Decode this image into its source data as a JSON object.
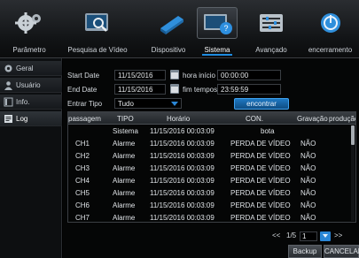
{
  "nav": {
    "tabs": [
      {
        "label": "Parâmetro",
        "icon": "gear-icon"
      },
      {
        "label": "Pesquisa de Vídeo",
        "icon": "video-search-icon"
      },
      {
        "label": "Dispositivo",
        "icon": "hard-disk-icon"
      },
      {
        "label": "Sistema",
        "icon": "system-info-icon"
      },
      {
        "label": "Avançado",
        "icon": "advanced-tools-icon"
      },
      {
        "label": "encerramento",
        "icon": "power-icon"
      }
    ],
    "active_tab": "Sistema"
  },
  "sidebar": {
    "items": [
      {
        "label": "Geral",
        "icon": "gear-small-icon"
      },
      {
        "label": "Usuário",
        "icon": "user-icon"
      },
      {
        "label": "Info.",
        "icon": "info-icon"
      },
      {
        "label": "Log",
        "icon": "log-icon"
      }
    ],
    "active_item": "Log"
  },
  "filters": {
    "start_date_label": "Start Date",
    "start_date": "11/15/2016",
    "start_time_label": "hora início",
    "start_time": "00:00:00",
    "end_date_label": "End Date",
    "end_date": "11/15/2016",
    "end_time_label": "fim tempos",
    "end_time": "23:59:59",
    "type_label": "Entrar Tipo",
    "type_value": "Tudo",
    "search_label": "encontrar"
  },
  "table": {
    "headers": [
      "passagem",
      "TIPO",
      "Horário",
      "CON.",
      "Gravação",
      "produção"
    ],
    "rows": [
      {
        "channel": "",
        "type": "Sistema",
        "time": "11/15/2016 00:03:09",
        "content": "bota",
        "record": ""
      },
      {
        "channel": "CH1",
        "type": "Alarme",
        "time": "11/15/2016 00:03:09",
        "content": "PERDA DE VÍDEO",
        "record": "NÃO"
      },
      {
        "channel": "CH2",
        "type": "Alarme",
        "time": "11/15/2016 00:03:09",
        "content": "PERDA DE VÍDEO",
        "record": "NÃO"
      },
      {
        "channel": "CH3",
        "type": "Alarme",
        "time": "11/15/2016 00:03:09",
        "content": "PERDA DE VÍDEO",
        "record": "NÃO"
      },
      {
        "channel": "CH4",
        "type": "Alarme",
        "time": "11/15/2016 00:03:09",
        "content": "PERDA DE VÍDEO",
        "record": "NÃO"
      },
      {
        "channel": "CH5",
        "type": "Alarme",
        "time": "11/15/2016 00:03:09",
        "content": "PERDA DE VÍDEO",
        "record": "NÃO"
      },
      {
        "channel": "CH6",
        "type": "Alarme",
        "time": "11/15/2016 00:03:09",
        "content": "PERDA DE VÍDEO",
        "record": "NÃO"
      },
      {
        "channel": "CH7",
        "type": "Alarme",
        "time": "11/15/2016 00:03:09",
        "content": "PERDA DE VÍDEO",
        "record": "NÃO"
      }
    ]
  },
  "pager": {
    "prev": "<<",
    "page_info": "1/5",
    "page_input": "1",
    "next": ">>"
  },
  "buttons": {
    "backup": "Backup",
    "cancel": "CANCELAR"
  },
  "colors": {
    "accent": "#1e8be0",
    "background": "#000000"
  }
}
